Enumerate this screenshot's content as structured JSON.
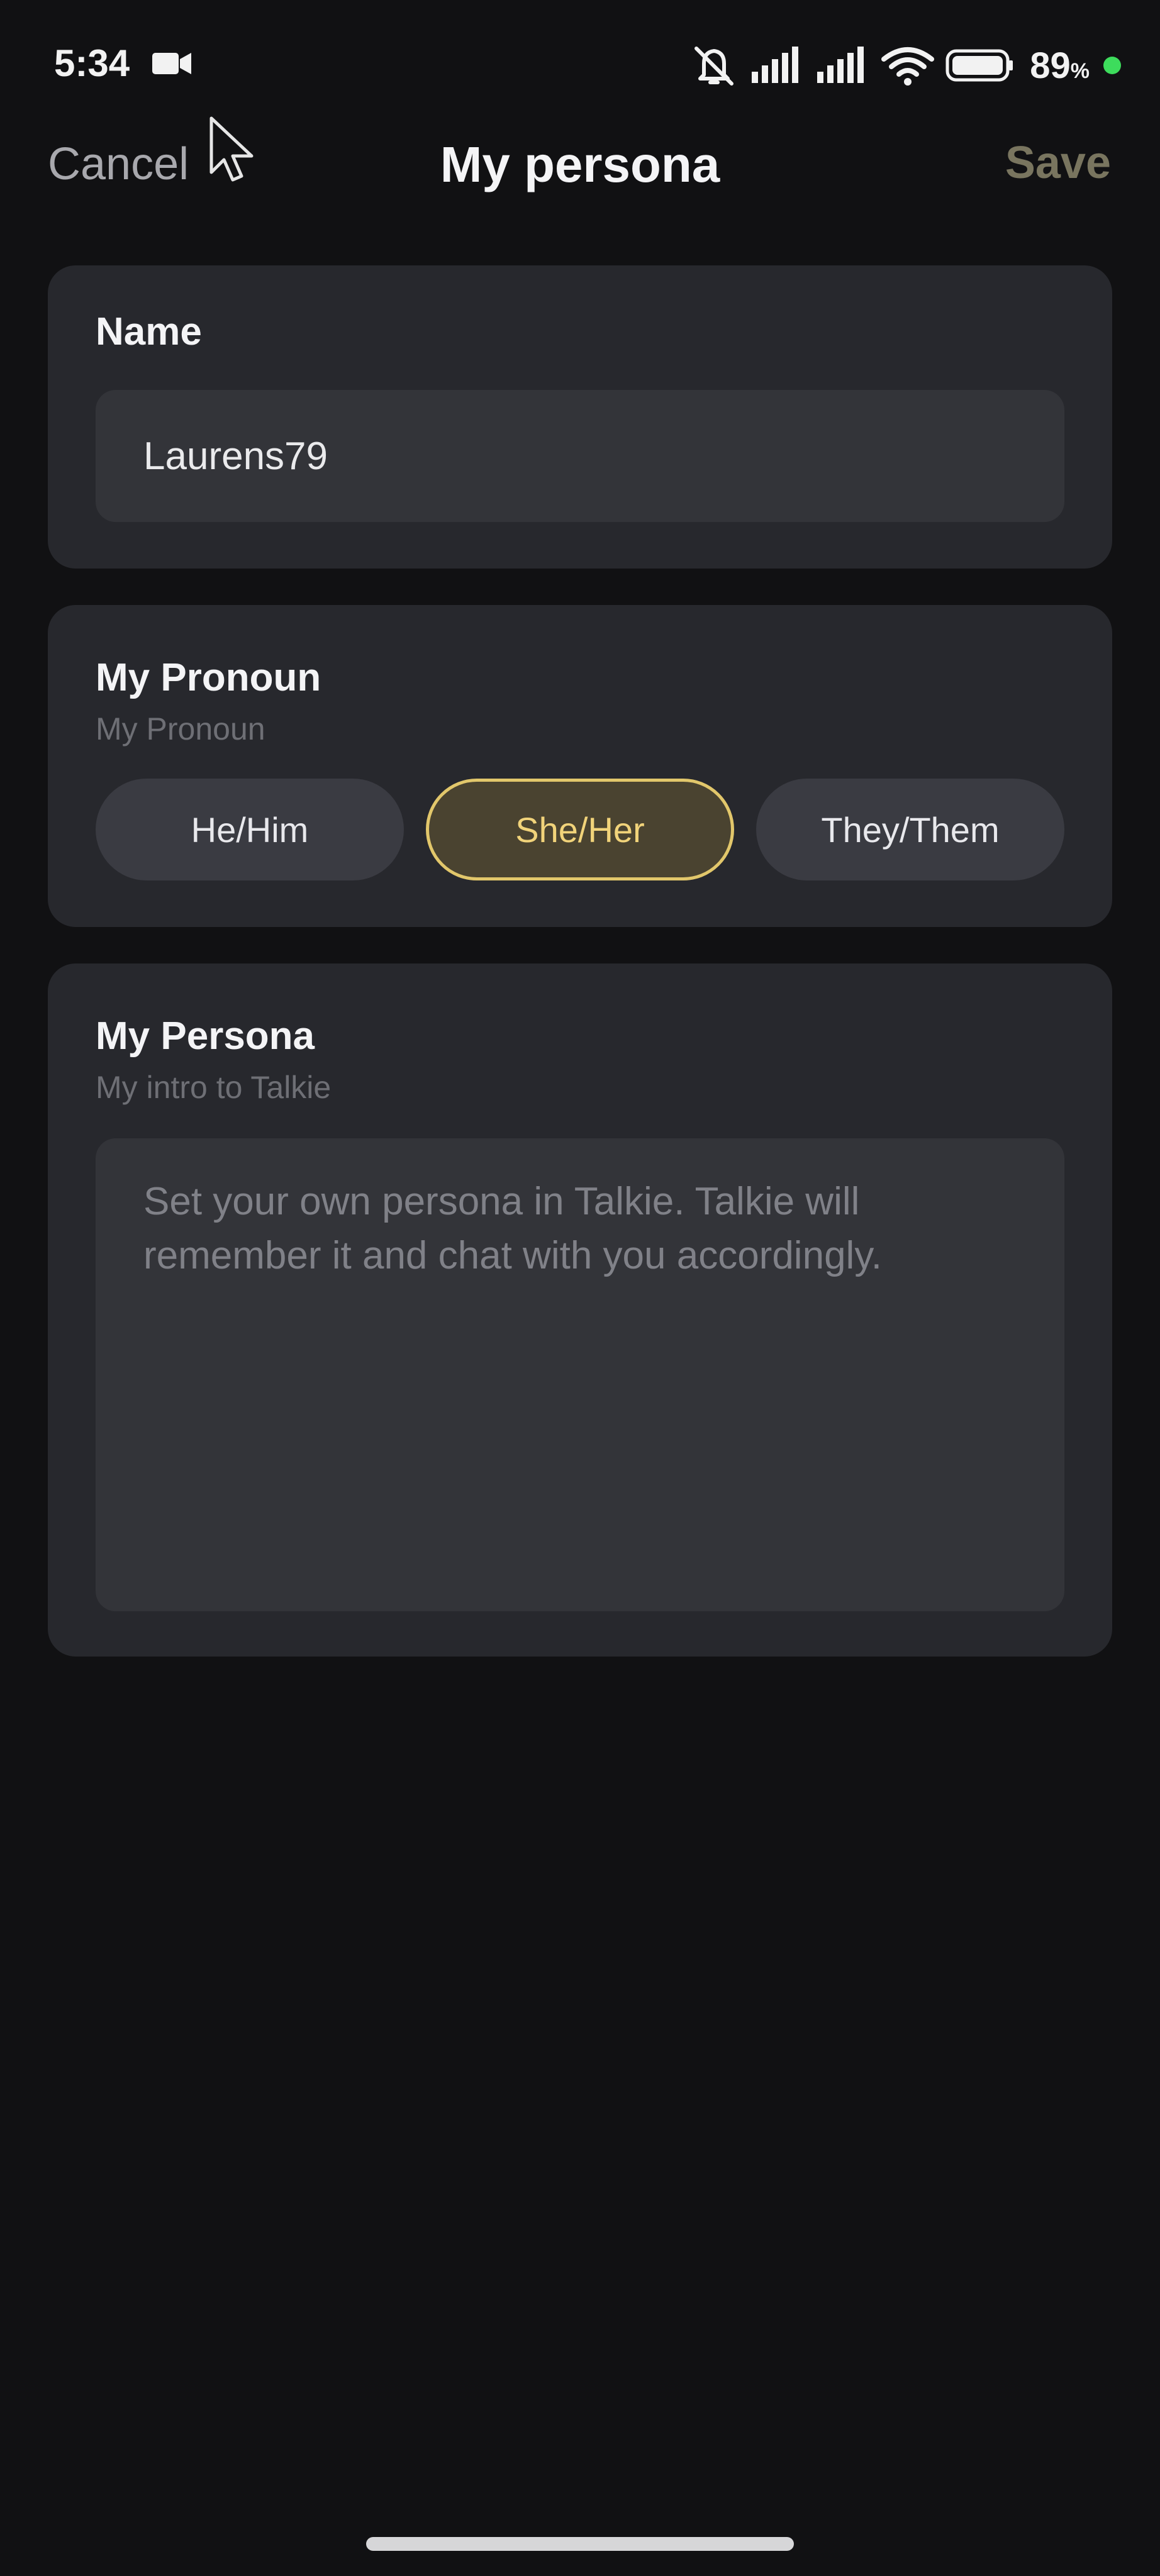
{
  "status_bar": {
    "time": "5:34",
    "battery_percent": "89",
    "battery_unit": "%",
    "icons": [
      "video-camera-icon",
      "mute-alarm-icon",
      "signal-icon",
      "signal-icon",
      "wifi-icon",
      "battery-icon"
    ],
    "dot_color": "#3ddc5c"
  },
  "header": {
    "cancel_label": "Cancel",
    "title": "My persona",
    "save_label": "Save"
  },
  "name_section": {
    "title": "Name",
    "value": "Laurens79"
  },
  "pronoun_section": {
    "title": "My Pronoun",
    "subtitle": "My Pronoun",
    "options": [
      {
        "label": "He/Him",
        "selected": false
      },
      {
        "label": "She/Her",
        "selected": true
      },
      {
        "label": "They/Them",
        "selected": false
      }
    ]
  },
  "persona_section": {
    "title": "My Persona",
    "subtitle": "My intro to Talkie",
    "placeholder": "Set your own persona in Talkie. Talkie will remember it and chat with you accordingly."
  },
  "colors": {
    "background": "#111113",
    "card": "#27282d",
    "field": "#333439",
    "accent": "#e2c76b",
    "save_disabled": "#79755f"
  }
}
